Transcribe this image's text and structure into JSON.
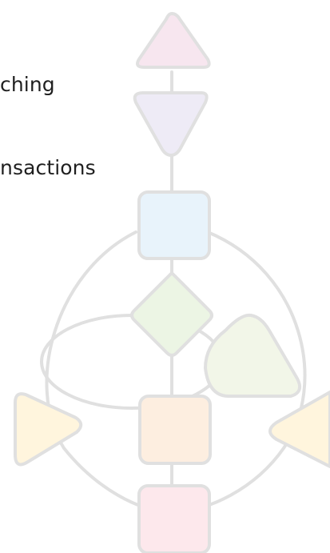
{
  "content": {
    "lines": [
      "ching",
      "nsactions"
    ]
  },
  "diagram": {
    "node_colors": {
      "top_triangle": "#f7e6ef",
      "second_triangle": "#eeebf6",
      "upper_square": "#e8f3fb",
      "diamond": "#ecf5e4",
      "right_triangle": "#f2f6e8",
      "left_triangle": "#fff5dd",
      "center_square": "#fdeee0",
      "right_edge_triangle": "#fff5dd",
      "bottom_square": "#fde8ec"
    },
    "stroke_color": "#e0e0e0"
  }
}
